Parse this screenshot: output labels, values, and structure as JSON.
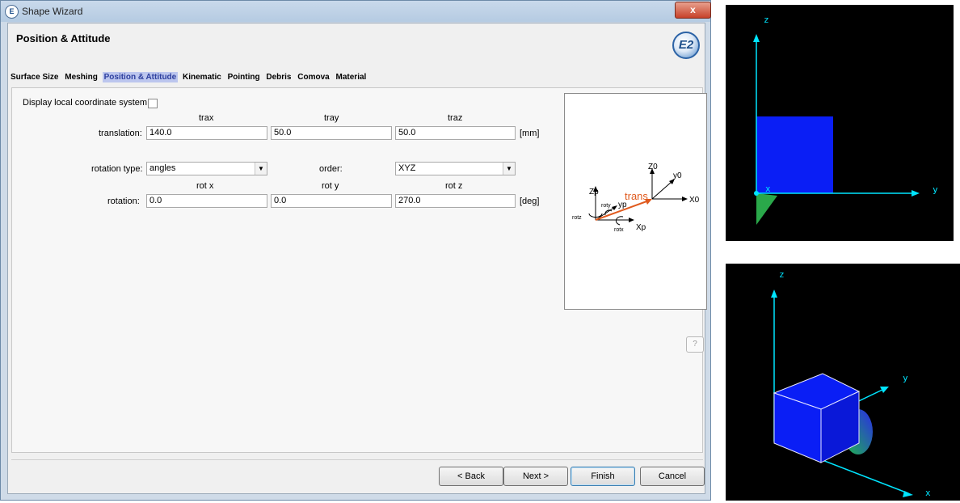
{
  "window": {
    "title": "Shape Wizard",
    "icon_text": "E",
    "close_label": "x"
  },
  "page": {
    "title": "Position & Attitude",
    "logo_text": "E2"
  },
  "tabs": [
    {
      "label": "Surface Size",
      "active": false
    },
    {
      "label": "Meshing",
      "active": false
    },
    {
      "label": "Position & Attitude",
      "active": true
    },
    {
      "label": "Kinematic",
      "active": false
    },
    {
      "label": "Pointing",
      "active": false
    },
    {
      "label": "Debris",
      "active": false
    },
    {
      "label": "Comova",
      "active": false
    },
    {
      "label": "Material",
      "active": false
    }
  ],
  "form": {
    "display_local_label": "Display local coordinate system:",
    "display_local_checked": false,
    "translation": {
      "label": "translation:",
      "headers": [
        "trax",
        "tray",
        "traz"
      ],
      "values": [
        "140.0",
        "50.0",
        "50.0"
      ],
      "unit": "[mm]"
    },
    "rotation_type": {
      "label": "rotation type:",
      "value": "angles"
    },
    "order": {
      "label": "order:",
      "value": "XYZ"
    },
    "rotation": {
      "label": "rotation:",
      "headers": [
        "rot x",
        "rot y",
        "rot z"
      ],
      "values": [
        "0.0",
        "0.0",
        "270.0"
      ],
      "unit": "[deg]"
    }
  },
  "diagram": {
    "labels": {
      "zp": "Zp",
      "yp": "yp",
      "xp": "Xp",
      "rotz": "rotz",
      "roty": "roty",
      "rotx": "rotx",
      "trans": "trans",
      "z0": "Z0",
      "y0": "y0",
      "x0": "X0"
    },
    "colors": {
      "trans": "#e05a1e",
      "axes": "#000000"
    }
  },
  "help_label": "?",
  "buttons": {
    "back": "< Back",
    "next": "Next >",
    "finish": "Finish",
    "cancel": "Cancel"
  },
  "views": {
    "top": {
      "z": "z",
      "y": "y",
      "x": "x"
    },
    "bottom": {
      "z": "z",
      "y": "y",
      "x": "x"
    },
    "colors": {
      "background": "#000000",
      "axis": "#00e5ff",
      "box": "#0a1ef5",
      "disc": "#22c04a"
    }
  }
}
